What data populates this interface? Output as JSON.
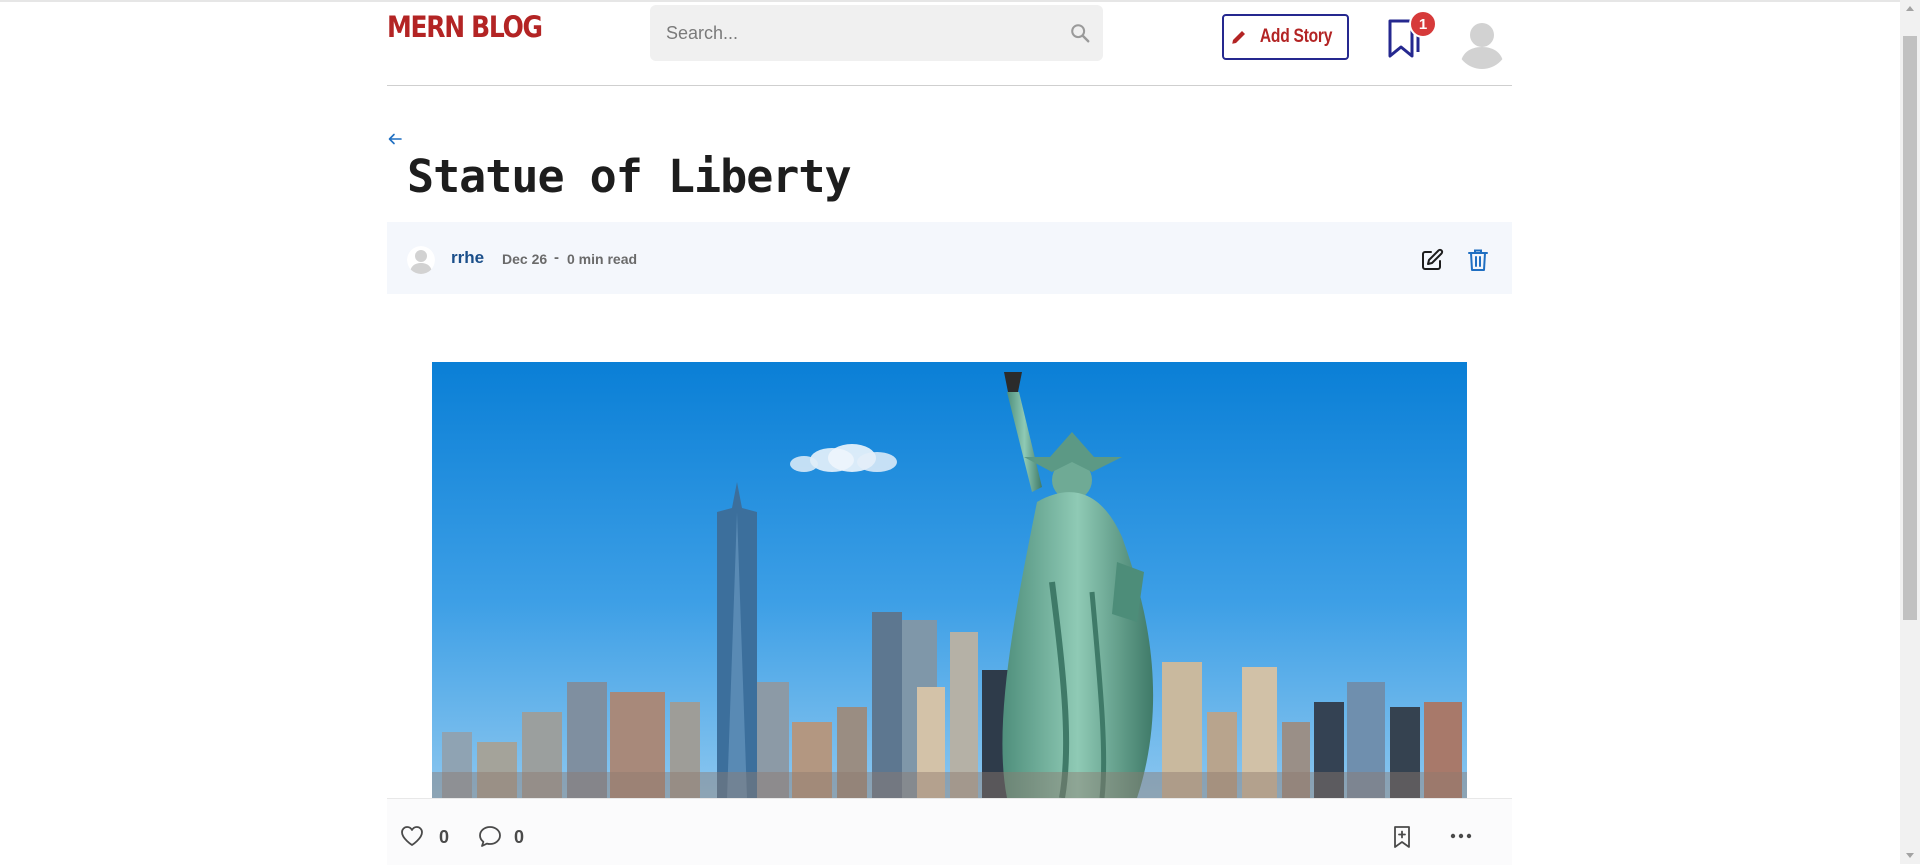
{
  "header": {
    "logo": "MERN BLOG",
    "search_placeholder": "Search...",
    "add_story_label": "Add Story",
    "bookmark_badge": "1"
  },
  "story": {
    "title": "Statue of Liberty",
    "author": "rrhe",
    "date": "Dec 26",
    "separator": "-",
    "read_time": "0 min read"
  },
  "actions": {
    "like_count": "0",
    "comment_count": "0"
  },
  "colors": {
    "brand_red": "#b32424",
    "navy": "#25288f",
    "link_blue": "#1b4f8a",
    "meta_bg": "#f4f7fc"
  },
  "icons": {
    "search": "search-icon",
    "pen": "pen-icon",
    "bookmark": "bookmark-icon",
    "avatar": "avatar-icon",
    "back": "arrow-left-icon",
    "edit": "edit-icon",
    "delete": "trash-icon",
    "like": "heart-icon",
    "comment": "comment-icon",
    "save": "bookmark-add-icon",
    "more": "more-horizontal-icon"
  }
}
